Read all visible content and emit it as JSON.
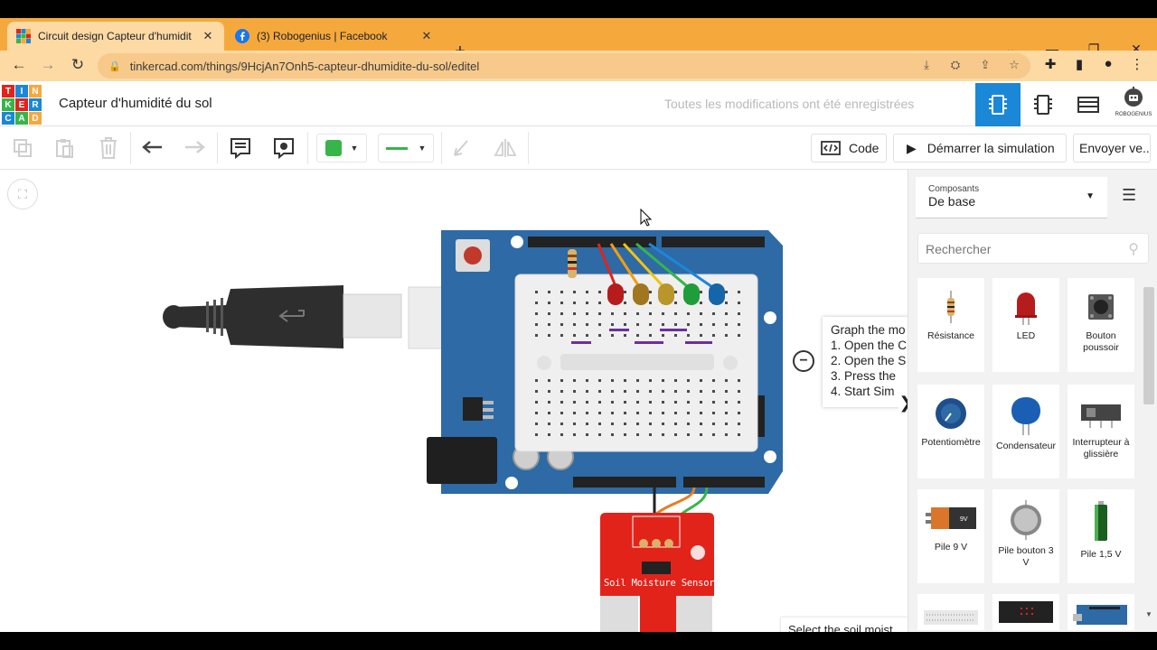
{
  "browser": {
    "tabs": [
      {
        "title": "Circuit design Capteur d'humidit",
        "active": true
      },
      {
        "title": "(3) Robogenius | Facebook",
        "active": false
      }
    ],
    "url": "tinkercad.com/things/9HcjAn7Onh5-capteur-dhumidite-du-sol/editel"
  },
  "logo_letters": [
    "T",
    "I",
    "N",
    "K",
    "E",
    "R",
    "C",
    "A",
    "D"
  ],
  "header": {
    "project_title": "Capteur d'humidité du sol",
    "save_status": "Toutes les modifications ont été enregistrées"
  },
  "toolbar": {
    "code_label": "Code",
    "start_sim_label": "Démarrer la simulation",
    "export_label": "Envoyer ve...",
    "fill_color": "#36b54a",
    "wire_color": "#36b54a"
  },
  "notes": {
    "lines": [
      "Graph the mo",
      "1. Open the C",
      "2. Open the S",
      "3. Press the",
      "4. Start Sim"
    ]
  },
  "selection_hint": "Select the soil moist",
  "avatar_label": "ROBOGENIUS",
  "sensor_label": "Soil Moisture Sensor",
  "components_panel": {
    "caption": "Composants",
    "selected": "De base",
    "search_placeholder": "Rechercher",
    "items": [
      {
        "label": "Résistance",
        "icon": "resistor-icon"
      },
      {
        "label": "LED",
        "icon": "led-icon"
      },
      {
        "label": "Bouton poussoir",
        "icon": "pushbutton-icon"
      },
      {
        "label": "Potentiomètre",
        "icon": "potentiometer-icon"
      },
      {
        "label": "Condensateur",
        "icon": "capacitor-icon"
      },
      {
        "label": "Interrupteur à glissière",
        "icon": "slide-switch-icon"
      },
      {
        "label": "Pile 9 V",
        "icon": "battery-9v-icon"
      },
      {
        "label": "Pile bouton 3 V",
        "icon": "coin-cell-icon"
      },
      {
        "label": "Pile 1,5 V",
        "icon": "battery-aa-icon"
      }
    ]
  },
  "colors": {
    "accent": "#1a88d6",
    "arduino": "#2d6aa6",
    "tab_bar": "#f5a93d",
    "sensor": "#e2231a"
  }
}
